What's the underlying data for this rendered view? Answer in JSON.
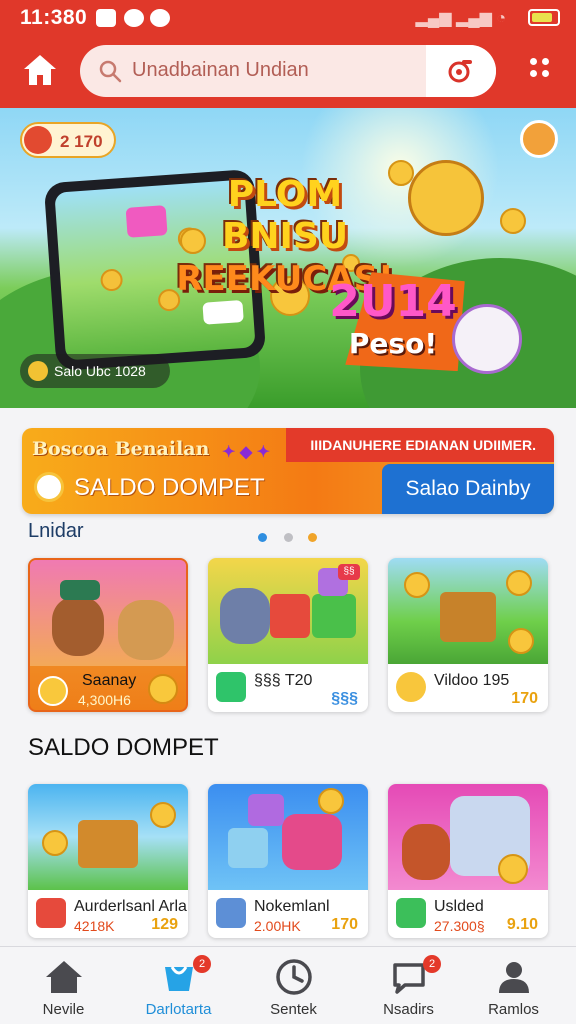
{
  "status": {
    "time": "11:380",
    "battery_color": "#e9e24d"
  },
  "header": {
    "search_placeholder": "Unadbainan Undian",
    "home_icon": "home-icon",
    "camera_icon": "camera-scan-icon",
    "menu_icon": "more-vertical-icon",
    "brand_color": "#e0382a"
  },
  "banner": {
    "coin_count": "2 170",
    "title_line1": "PLOM BNISU",
    "title_line2": "REEKUCAS!",
    "year": "2U14",
    "year_sub": "Peso!",
    "caption": "Salo Ubc 1028"
  },
  "promo": {
    "title_small": "Boscoa Benailan",
    "red_text": "IIIDANUHERE EDIANAN UDIIMER.",
    "main_title": "SALDO DOMPET",
    "cta_label": "Salao Dainby",
    "cta_color": "#1e71d2"
  },
  "section1": {
    "label": "Lnidar",
    "cards": [
      {
        "title": "Saanay",
        "subtitle": "4,300H6",
        "right": "",
        "tag": "",
        "highlighted": true
      },
      {
        "title": "§§§ T20",
        "subtitle": "",
        "right": "§§§",
        "tag": "§§",
        "highlighted": false
      },
      {
        "title": "Vildoo 195",
        "subtitle": "",
        "right": "170",
        "tag": "",
        "highlighted": false
      }
    ]
  },
  "section2": {
    "label": "SALDO DOMPET",
    "cards": [
      {
        "title": "Aurderlsanl Arla",
        "subtitle": "4218K",
        "right": "129"
      },
      {
        "title": "Nokemlanl",
        "subtitle": "2.00HK",
        "right": "170"
      },
      {
        "title": "Uslded",
        "subtitle": "27.300§",
        "right": "9.10"
      }
    ]
  },
  "bottom_nav": [
    {
      "label": "Nevile",
      "icon": "home-icon",
      "badge": ""
    },
    {
      "label": "Darlotarta",
      "icon": "bag-icon",
      "badge": "2"
    },
    {
      "label": "Sentek",
      "icon": "clock-icon",
      "badge": ""
    },
    {
      "label": "Nsadirs",
      "icon": "chat-icon",
      "badge": "2"
    },
    {
      "label": "Ramlos",
      "icon": "profile-icon",
      "badge": ""
    }
  ]
}
